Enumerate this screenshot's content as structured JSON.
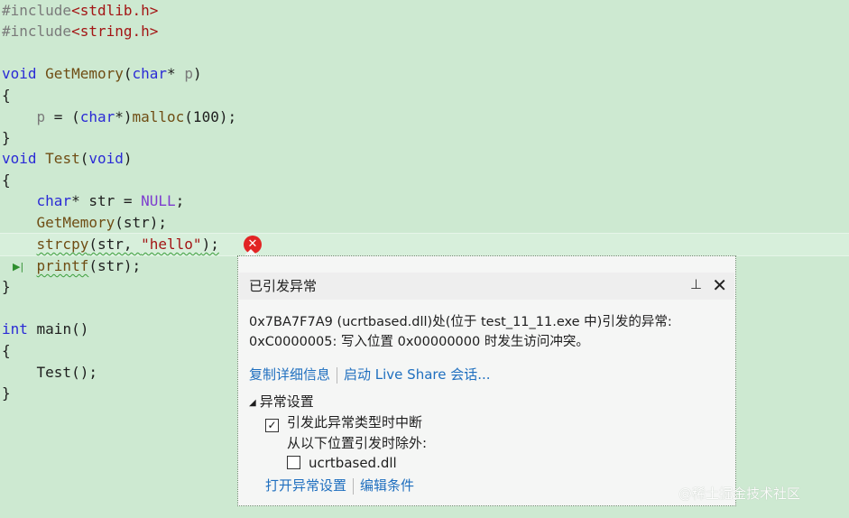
{
  "code": {
    "l1_kw": "#include",
    "l1_file": "<stdlib.h>",
    "l2_kw": "#include",
    "l2_file": "<string.h>",
    "l4_void": "void",
    "l4_name": "GetMemory",
    "l4_open": "(",
    "l4_char": "char",
    "l4_star": "* ",
    "l4_param": "p",
    "l4_close": ")",
    "l5": "{",
    "l6_indent": "    ",
    "l6_p": "p",
    "l6_eq": " = (",
    "l6_char": "char",
    "l6_cast": "*)",
    "l6_malloc": "malloc",
    "l6_rest": "(100);",
    "l7": "}",
    "l8_void": "void",
    "l8_name": "Test",
    "l8_open": "(",
    "l8_void2": "void",
    "l8_close": ")",
    "l9": "{",
    "l10_indent": "    ",
    "l10_char": "char",
    "l10_rest": "* str = ",
    "l10_null": "NULL",
    "l10_semi": ";",
    "l11_indent": "    ",
    "l11_fn": "GetMemory",
    "l11_rest": "(str);",
    "l12_indent": "    ",
    "l12_fn": "strcpy",
    "l12_args": "(str, ",
    "l12_str": "\"hello\"",
    "l12_end": ");",
    "l13_indent": "    ",
    "l13_fn": "printf",
    "l13_rest": "(str);",
    "l14": "}",
    "l16_int": "int",
    "l16_main": " main()",
    "l17": "{",
    "l18_indent": "    ",
    "l18_fn": "Test",
    "l18_rest": "();",
    "l19": "}"
  },
  "gutter": {
    "next_statement_icon": "next-statement-arrow",
    "next_glyph": "▶|"
  },
  "error_icon": {
    "name": "error-icon",
    "glyph": "✕",
    "color": "#e22424"
  },
  "popup": {
    "title": "已引发异常",
    "pin_glyph": "⊥",
    "close_glyph": "✕",
    "message_line1": "0x7BA7F7A9 (ucrtbased.dll)处(位于 test_11_11.exe 中)引发的异常:",
    "message_line2": "0xC0000005: 写入位置 0x00000000 时发生访问冲突。",
    "link_copy_details": "复制详细信息",
    "link_live_share": "启动 Live Share 会话...",
    "section_title": "异常设置",
    "section_triangle": "◢",
    "option_break": "引发此异常类型时中断",
    "option_break_checked": true,
    "except_label": "从以下位置引发时除外:",
    "option_ucrtbased": "ucrtbased.dll",
    "option_ucrtbased_checked": false,
    "link_open_settings": "打开异常设置",
    "link_edit_conditions": "编辑条件"
  },
  "watermark": "@稀土掘金技术社区",
  "colors": {
    "background": "#cde9d1",
    "keyword": "#2b2bd6",
    "string": "#a31515",
    "function": "#6f4d14",
    "link": "#1f6fbf"
  }
}
